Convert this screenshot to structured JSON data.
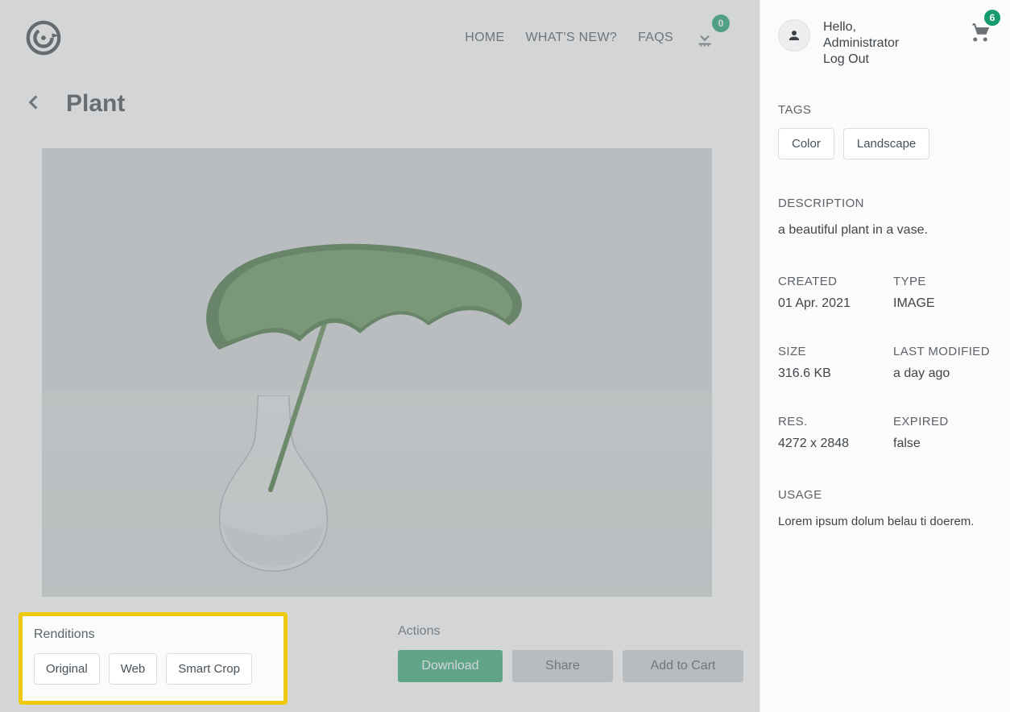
{
  "header": {
    "nav": {
      "home": "HOME",
      "whatsNew": "WHAT'S NEW?",
      "faqs": "FAQS"
    },
    "downloadBadge": "0"
  },
  "titlebar": {
    "title": "Plant"
  },
  "renditions": {
    "title": "Renditions",
    "buttons": {
      "original": "Original",
      "web": "Web",
      "smartCrop": "Smart Crop"
    }
  },
  "actions": {
    "title": "Actions",
    "download": "Download",
    "share": "Share",
    "addToCart": "Add to Cart"
  },
  "user": {
    "greeting": "Hello,",
    "name": "Administrator",
    "logout": "Log Out",
    "cartCount": "6"
  },
  "sidebar": {
    "tagsTitle": "TAGS",
    "tags": {
      "color": "Color",
      "landscape": "Landscape"
    },
    "descriptionTitle": "DESCRIPTION",
    "description": "a beautiful plant in a vase.",
    "meta": {
      "createdLabel": "CREATED",
      "createdValue": "01 Apr. 2021",
      "typeLabel": "TYPE",
      "typeValue": "IMAGE",
      "sizeLabel": "SIZE",
      "sizeValue": "316.6 KB",
      "modifiedLabel": "LAST MODIFIED",
      "modifiedValue": "a day ago",
      "resLabel": "RES.",
      "resValue": "4272 x 2848",
      "expiredLabel": "EXPIRED",
      "expiredValue": "false"
    },
    "usageTitle": "USAGE",
    "usageText": "Lorem ipsum dolum belau ti doerem."
  }
}
